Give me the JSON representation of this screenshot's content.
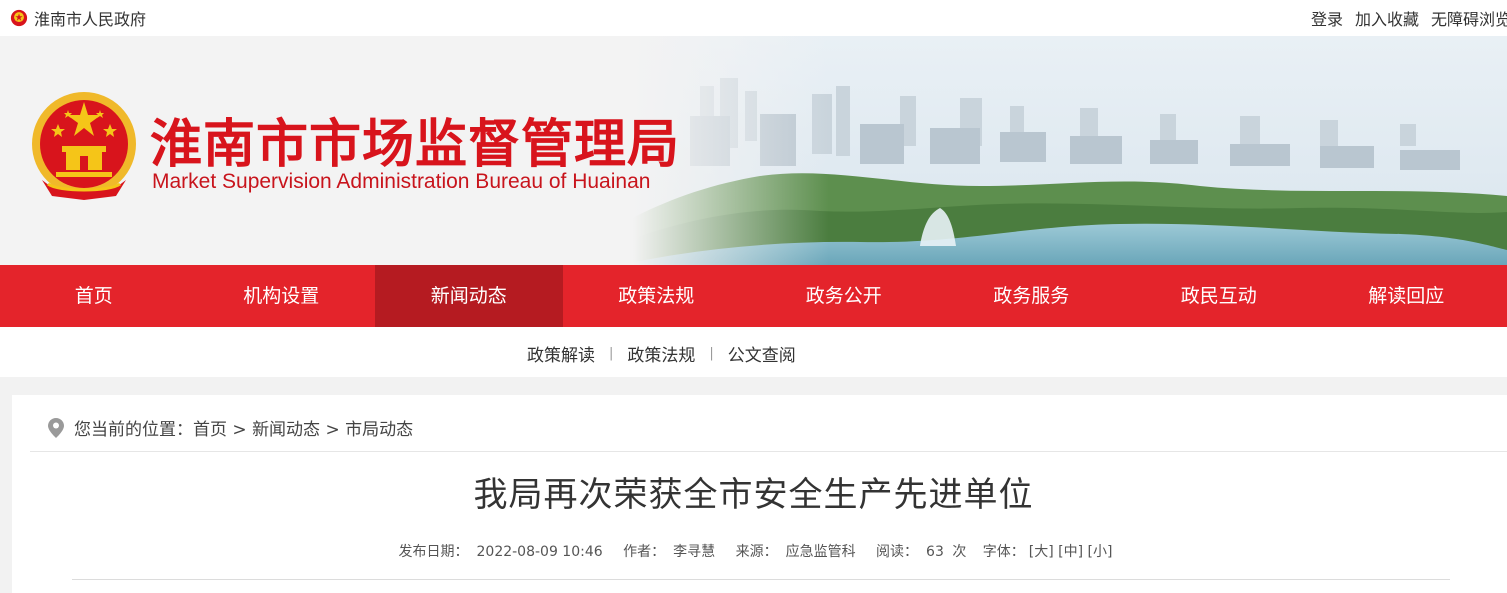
{
  "topbar": {
    "site_name": "淮南市人民政府",
    "links": [
      "登录",
      "加入收藏",
      "无障碍浏览"
    ]
  },
  "banner": {
    "title_cn": "淮南市市场监督管理局",
    "title_en": "Market Supervision Administration Bureau of Huainan"
  },
  "nav": {
    "items": [
      "首页",
      "机构设置",
      "新闻动态",
      "政策法规",
      "政务公开",
      "政务服务",
      "政民互动",
      "解读回应"
    ],
    "active_index": 2
  },
  "subnav": {
    "items": [
      "政策解读",
      "政策法规",
      "公文查阅"
    ],
    "separator": "|"
  },
  "breadcrumb": {
    "prefix": "您当前的位置：",
    "items": [
      "首页",
      "新闻动态",
      "市局动态"
    ],
    "separator": ">"
  },
  "article": {
    "title": "我局再次荣获全市安全生产先进单位",
    "publish_label": "发布日期：",
    "publish_date": "2022-08-09 10:46",
    "author_label": "作者：",
    "author": "李寻慧",
    "source_label": "来源：",
    "source": "应急监管科",
    "views_label": "阅读：",
    "views": "63",
    "views_unit": "次",
    "font_label": "字体：",
    "font_sizes": [
      "[大]",
      "[中]",
      "[小]"
    ]
  },
  "colors": {
    "nav_red": "#e4242b",
    "nav_active": "#b51b21",
    "title_red": "#d8141c"
  }
}
